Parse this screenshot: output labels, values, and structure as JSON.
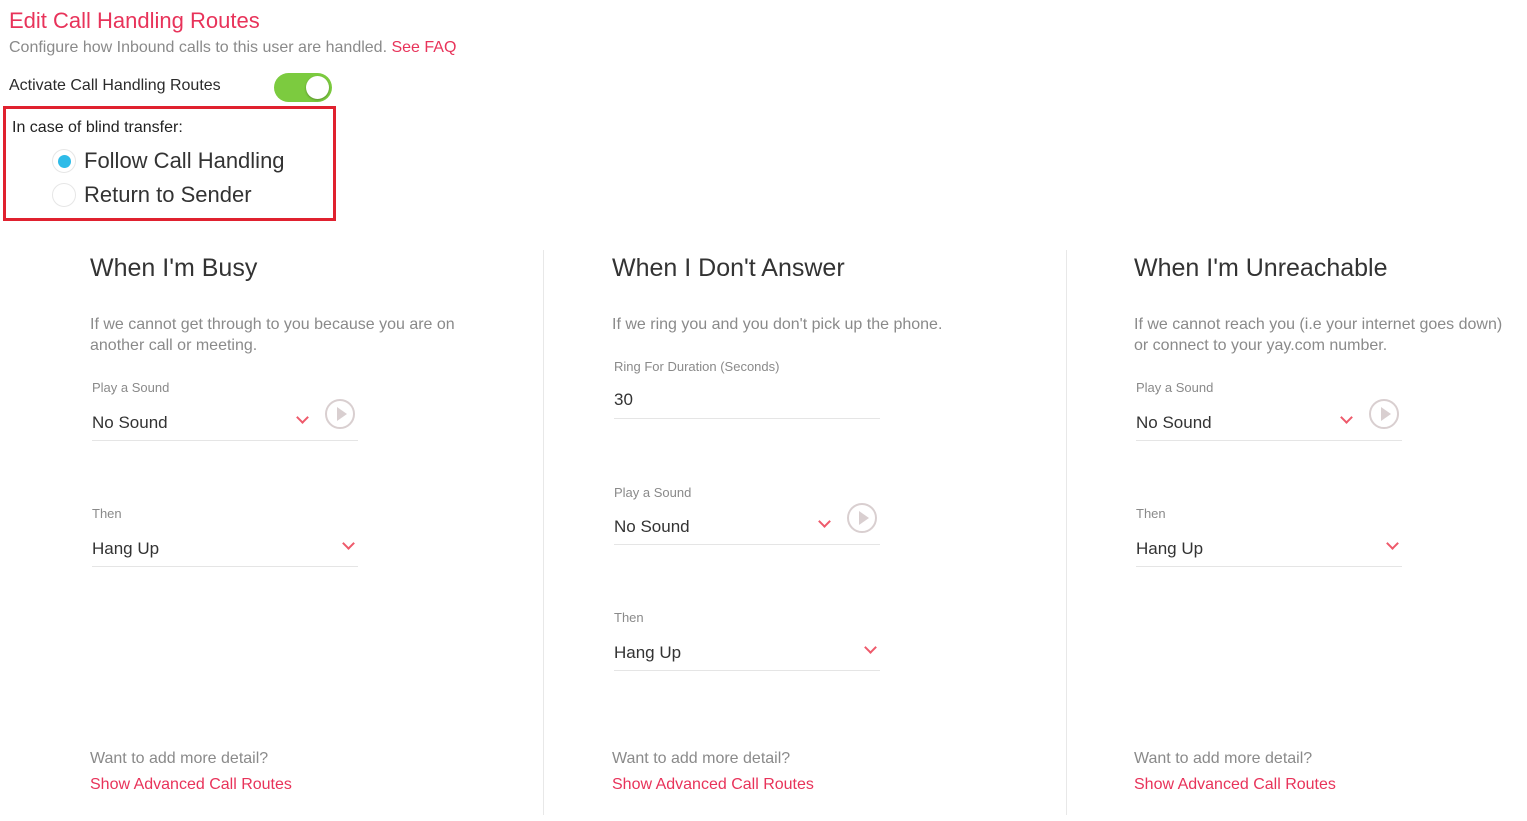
{
  "header": {
    "title": "Edit Call Handling Routes",
    "subtitle": "Configure how Inbound calls to this user are handled.",
    "faq_link": "See FAQ"
  },
  "activate": {
    "label": "Activate Call Handling Routes",
    "enabled": true
  },
  "blind_transfer": {
    "label": "In case of blind transfer:",
    "options": [
      {
        "label": "Follow Call Handling",
        "selected": true
      },
      {
        "label": "Return to Sender",
        "selected": false
      }
    ]
  },
  "columns": {
    "busy": {
      "title": "When I'm Busy",
      "description": "If we cannot get through to you because you are on another call or meeting.",
      "sound_label": "Play a Sound",
      "sound_value": "No Sound",
      "then_label": "Then",
      "then_value": "Hang Up",
      "more_text": "Want to add more detail?",
      "advanced_link": "Show Advanced Call Routes"
    },
    "no_answer": {
      "title": "When I Don't Answer",
      "description": "If we ring you and you don't pick up the phone.",
      "ring_label": "Ring For Duration (Seconds)",
      "ring_value": "30",
      "sound_label": "Play a Sound",
      "sound_value": "No Sound",
      "then_label": "Then",
      "then_value": "Hang Up",
      "more_text": "Want to add more detail?",
      "advanced_link": "Show Advanced Call Routes"
    },
    "unreachable": {
      "title": "When I'm Unreachable",
      "description": "If we cannot reach you (i.e your internet goes down) or connect to your yay.com number.",
      "sound_label": "Play a Sound",
      "sound_value": "No Sound",
      "then_label": "Then",
      "then_value": "Hang Up",
      "more_text": "Want to add more detail?",
      "advanced_link": "Show Advanced Call Routes"
    }
  },
  "colors": {
    "accent": "#e8335a",
    "toggle_on": "#7ccb3f",
    "radio_selected": "#2ebbe8",
    "highlight_border": "#e0212f"
  }
}
